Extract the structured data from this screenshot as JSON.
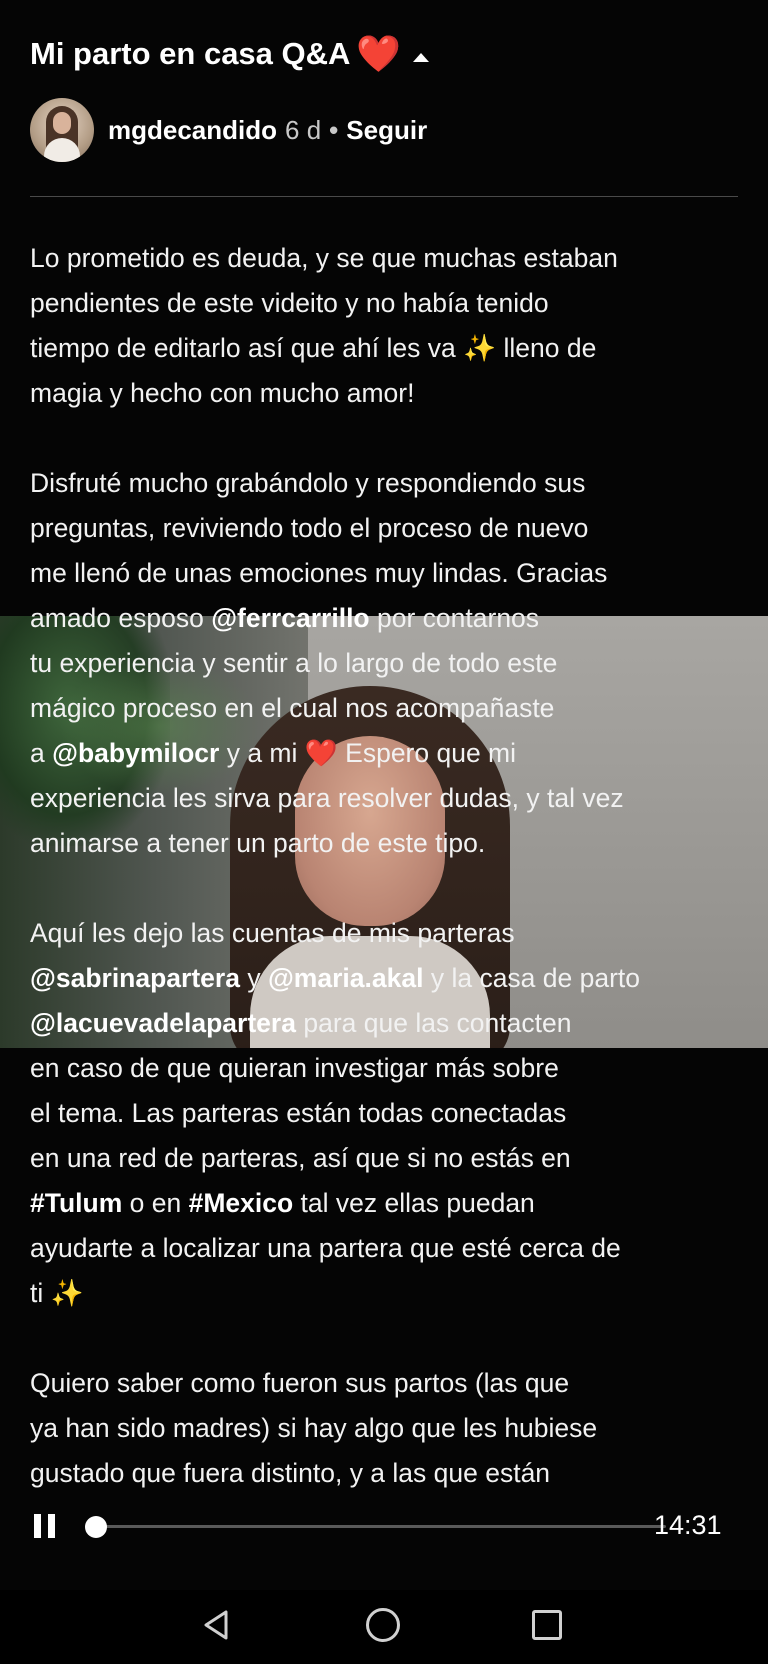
{
  "post": {
    "title": "Mi parto en casa Q&A",
    "title_heart": "❤️",
    "author": "mgdecandido",
    "age": "6 d",
    "separator": "•",
    "follow_label": "Seguir"
  },
  "caption": {
    "p1": [
      "Lo prometido es deuda, y se que muchas estaban",
      "pendientes de este videito y no había tenido",
      "tiempo de editarlo así que ahí les va",
      "✨",
      "lleno de",
      "magia y hecho con mucho amor!"
    ],
    "p2": [
      "Disfruté mucho grabándolo y respondiendo sus",
      "preguntas, reviviendo todo el proceso de nuevo",
      "me llenó de unas emociones muy lindas. Gracias",
      "amado esposo",
      "@ferrcarrillo",
      "por contarnos",
      "tu experiencia y sentir a lo largo de todo este",
      "mágico proceso en el cual nos acompañaste",
      "a",
      "@babymilocr",
      "y a mi",
      "❤️",
      "Espero que mi",
      "experiencia les sirva para resolver dudas, y tal vez",
      "animarse a tener un parto de este tipo."
    ],
    "p3": [
      "Aquí les dejo las cuentas de mis parteras",
      "@sabrinapartera",
      "y",
      "@maria.akal",
      "y la casa de parto",
      "@lacuevadelapartera",
      "para que las contacten",
      "en caso de que quieran investigar más sobre",
      "el tema. Las parteras están todas conectadas",
      "en una red de parteras, así que si no estás en",
      "#Tulum",
      "o en",
      "#Mexico",
      "tal vez ellas puedan",
      "ayudarte a localizar una partera que esté cerca de",
      "ti",
      "✨"
    ],
    "p4": [
      "Quiero saber como fueron sus partos (las que",
      "ya han sido madres) si hay algo que les hubiese",
      "gustado que fuera distinto, y a las que están"
    ]
  },
  "player": {
    "time_remaining": "14:31",
    "progress": 0.01,
    "pause_icon": "pause-icon"
  },
  "navbar": {
    "back_icon": "back-triangle-icon",
    "home_icon": "home-circle-icon",
    "recents_icon": "recents-square-icon"
  },
  "colors": {
    "background": "#050505",
    "heart": "#e8242b",
    "sparkle": "#f7d95a"
  }
}
